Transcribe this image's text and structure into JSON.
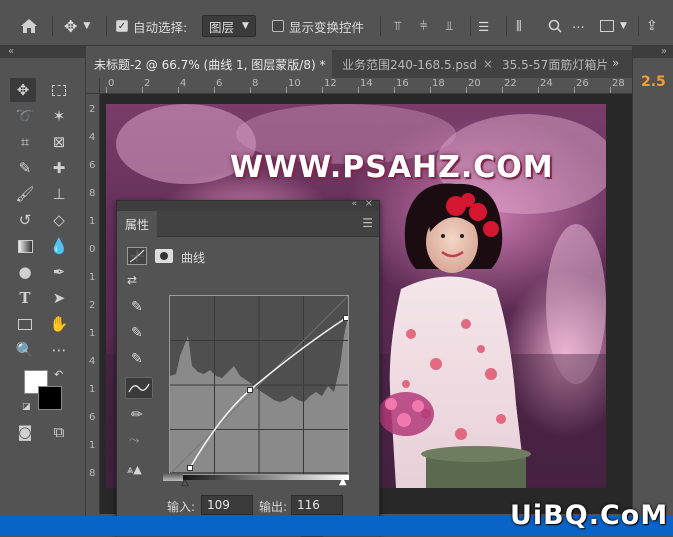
{
  "options_bar": {
    "auto_select_label": "自动选择:",
    "auto_select_checked": true,
    "auto_select_target": "图层",
    "show_transform_label": "显示变换控件",
    "show_transform_checked": false
  },
  "tabs": [
    {
      "label": "未标题-2 @ 66.7% (曲线 1, 图层蒙版/8) *",
      "active": true
    },
    {
      "label": "业务范围240-168.5.psd",
      "active": false
    },
    {
      "label": "35.5-57面筋灯箱片",
      "active": false
    }
  ],
  "ruler_h_ticks": [
    "0",
    "2",
    "4",
    "6",
    "8",
    "10",
    "12",
    "14",
    "16",
    "18",
    "20",
    "22",
    "24",
    "26",
    "28"
  ],
  "ruler_v_ticks": [
    "2",
    "4",
    "6",
    "8",
    "1",
    "0",
    "1",
    "2",
    "1",
    "4",
    "1",
    "6",
    "1",
    "8"
  ],
  "canvas": {
    "overlay_text": "WWW.PSAHZ.COM"
  },
  "right_panel": {
    "value": "2.5"
  },
  "properties_panel": {
    "tab_label": "属性",
    "adjustment_name": "曲线",
    "input_label": "输入:",
    "input_value": "109",
    "output_label": "输出:",
    "output_value": "116"
  },
  "watermark": "UiBQ.CoM",
  "colors": {
    "ui_bg": "#535353",
    "panel_dark": "#424242",
    "accent_orange": "#f0a030",
    "taskbar_blue": "#0a64c8"
  }
}
